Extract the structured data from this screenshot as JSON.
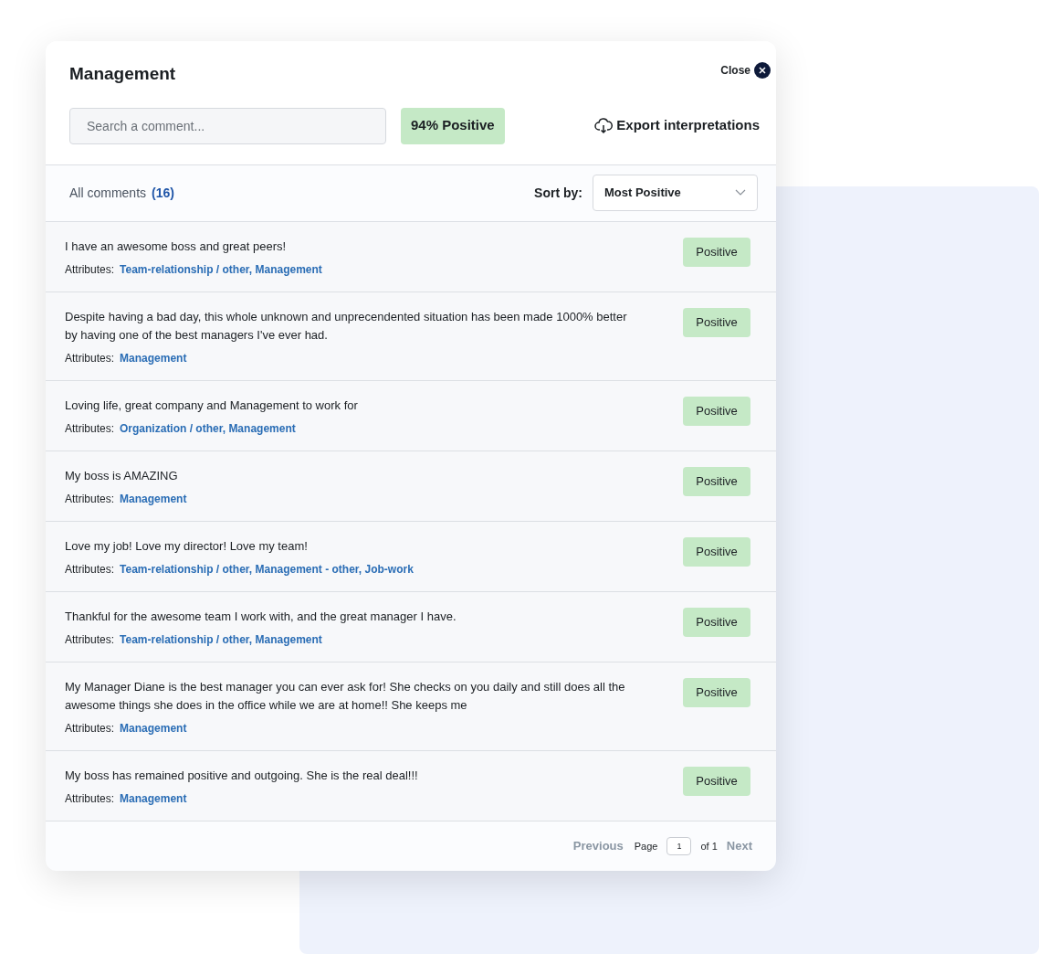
{
  "dialog": {
    "title": "Management",
    "close_label": "Close"
  },
  "search": {
    "placeholder": "Search a comment..."
  },
  "score_badge": "94% Positive",
  "export_label": "Export interpretations",
  "summary": {
    "label": "All comments",
    "count": "(16)"
  },
  "sort": {
    "label": "Sort by:",
    "value": "Most Positive"
  },
  "comments": [
    {
      "text": "I have an awesome boss and great peers!",
      "attributes_label": "Attributes:",
      "attributes": "Team-relationship / other, Management",
      "sentiment": "Positive"
    },
    {
      "text": "Despite having a bad day, this whole unknown and unprecendented situation has been made 1000% better by having one of the best managers I've ever had.",
      "attributes_label": "Attributes:",
      "attributes": "Management",
      "sentiment": "Positive"
    },
    {
      "text": "Loving life, great company and Management to work for",
      "attributes_label": "Attributes:",
      "attributes": "Organization / other, Management",
      "sentiment": "Positive"
    },
    {
      "text": "My boss is AMAZING",
      "attributes_label": "Attributes:",
      "attributes": "Management",
      "sentiment": "Positive"
    },
    {
      "text": "Love my job! Love my director! Love my team!",
      "attributes_label": "Attributes:",
      "attributes": "Team-relationship / other, Management - other, Job-work",
      "sentiment": "Positive"
    },
    {
      "text": "Thankful for the awesome team I work with, and the great manager I have.",
      "attributes_label": "Attributes:",
      "attributes": "Team-relationship / other, Management",
      "sentiment": "Positive"
    },
    {
      "text": "My Manager Diane is the best manager you can ever ask for! She checks on you daily and still does all the awesome things she does in the office while we are at home!! She keeps me",
      "attributes_label": "Attributes:",
      "attributes": "Management",
      "sentiment": "Positive"
    },
    {
      "text": "My boss has remained positive and outgoing. She is the real deal!!!",
      "attributes_label": "Attributes:",
      "attributes": "Management",
      "sentiment": "Positive"
    }
  ],
  "pagination": {
    "previous": {
      "label": "Previous",
      "disabled": true
    },
    "page_label": "Page",
    "page_value": "1",
    "of_label": "of 1",
    "next": {
      "label": "Next",
      "disabled": true
    }
  }
}
